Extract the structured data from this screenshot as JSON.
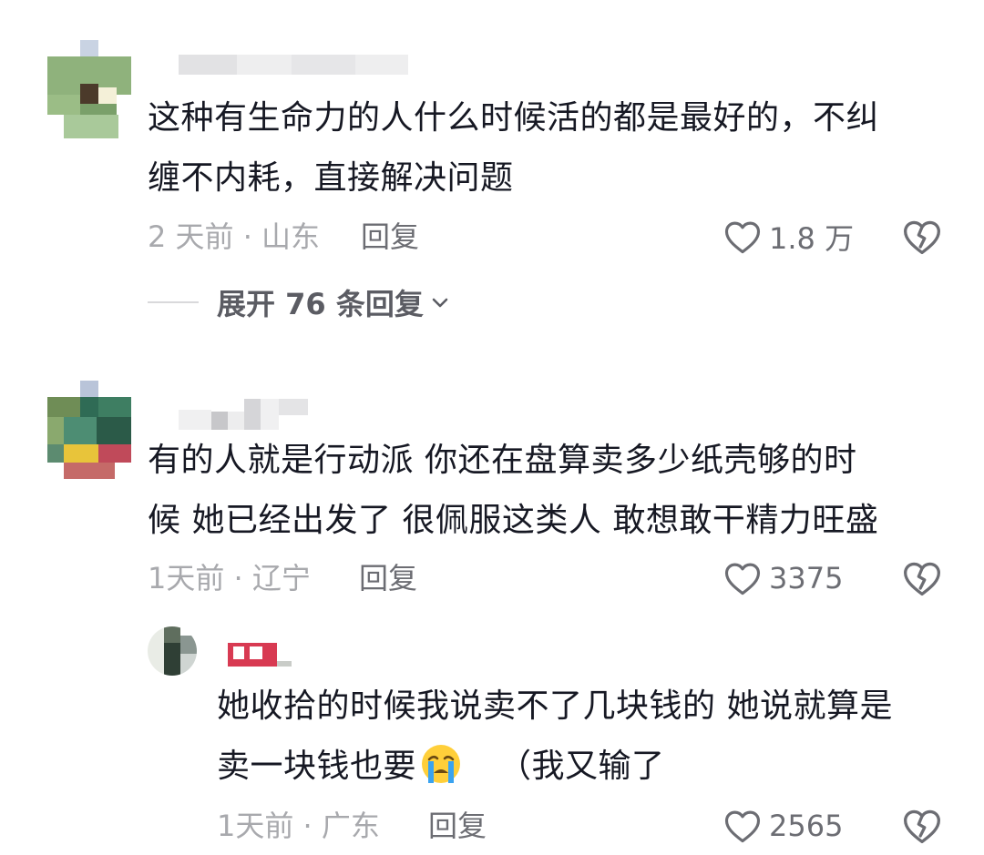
{
  "comments": [
    {
      "text_line1": "这种有生命力的人什么时候活的都是最好的，不纠",
      "text_line2": "缠不内耗，直接解决问题",
      "meta": "2 天前 · 山东",
      "reply_label": "回复",
      "like_count": "1.8 万",
      "expand_label": "展开 76 条回复",
      "expand_chevron": "⌄"
    },
    {
      "text_line1": "有的人就是行动派 你还在盘算卖多少纸壳够的时",
      "text_line2": "候 她已经出发了 很佩服这类人 敢想敢干精力旺盛",
      "meta": "1天前 · 辽宁",
      "reply_label": "回复",
      "like_count": "3375",
      "reply": {
        "text_line1": "她收拾的时候我说卖不了几块钱的 她说就算是",
        "text_line2_before": "卖一块钱也要",
        "emoji": "crying-face-emoji",
        "text_line2_after": "（我又输了",
        "meta": "1天前 · 广东",
        "reply_label": "回复",
        "like_count": "2565"
      }
    }
  ],
  "colors": {
    "text_primary": "#161823",
    "meta_gray": "#a8a9ad",
    "action_gray": "#6c6d73"
  },
  "icons": {
    "like": "heart-outline-icon",
    "dislike": "broken-heart-icon"
  }
}
